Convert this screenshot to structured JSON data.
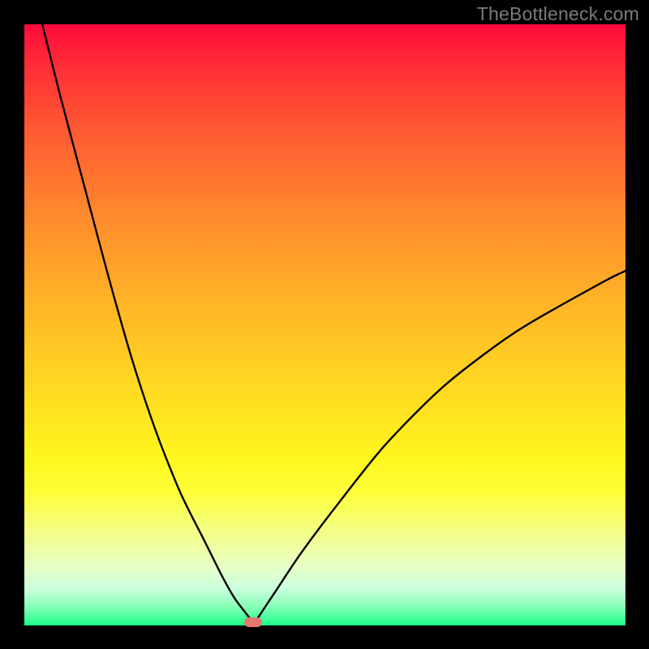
{
  "watermark": "TheBottleneck.com",
  "colors": {
    "curve_stroke": "#000000",
    "min_marker": "#e4786e"
  },
  "chart_data": {
    "type": "line",
    "title": "",
    "xlabel": "",
    "ylabel": "",
    "xlim": [
      0,
      100
    ],
    "ylim": [
      0,
      100
    ],
    "x": [
      3,
      6,
      10,
      14,
      18,
      22,
      26,
      30,
      33,
      35,
      36.5,
      37.5,
      38,
      38.8,
      40,
      42,
      46,
      52,
      60,
      70,
      82,
      96,
      100
    ],
    "values": [
      100,
      88,
      73,
      58,
      44,
      32,
      22,
      14,
      8,
      4.5,
      2.5,
      1.2,
      0.5,
      1.2,
      3,
      6,
      12,
      20,
      30,
      40,
      49,
      57,
      59
    ],
    "min_marker": {
      "x": 38,
      "y": 0.5
    },
    "annotations": []
  }
}
